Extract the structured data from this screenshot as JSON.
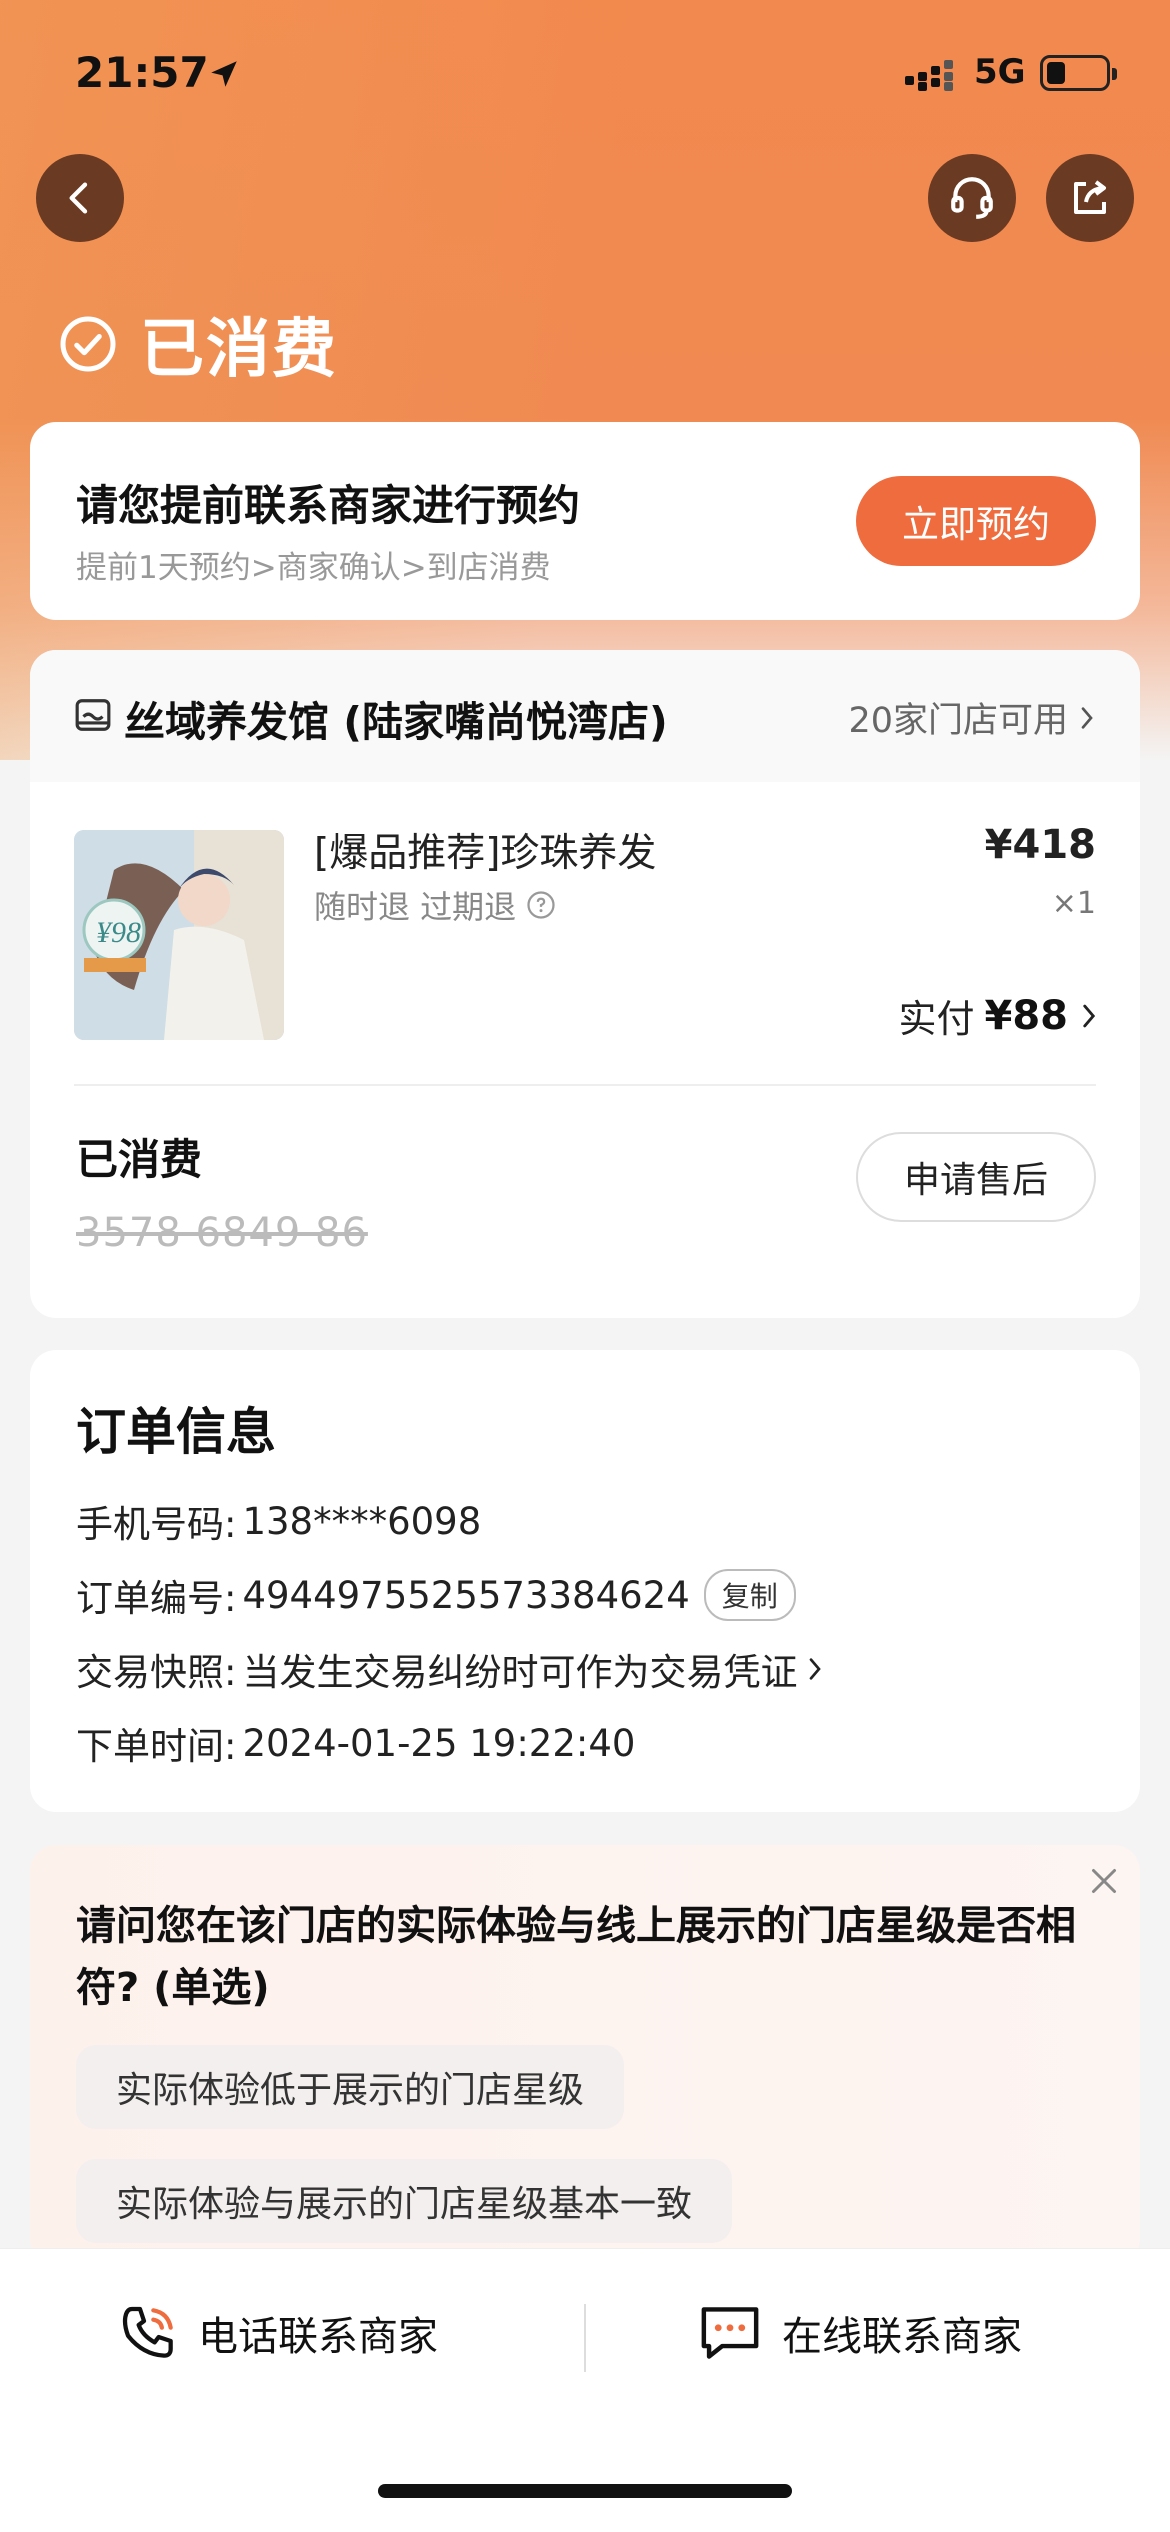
{
  "status_bar": {
    "time": "21:57",
    "network": "5G"
  },
  "header": {
    "status_title": "已消费"
  },
  "booking": {
    "title": "请您提前联系商家进行预约",
    "steps": "提前1天预约>商家确认>到店消费",
    "button": "立即预约"
  },
  "store": {
    "name": "丝域养发馆 (陆家嘴尚悦湾店)",
    "available": "20家门店可用",
    "product": {
      "name": "[爆品推荐]珍珠养发",
      "tags": "随时退 过期退",
      "price": "¥418",
      "qty": "×1",
      "paid_label": "实付",
      "paid_amount": "¥88",
      "image_text": "¥98"
    },
    "consumed_label": "已消费",
    "voucher_code": "3578 6849 86",
    "after_sale_button": "申请售后"
  },
  "order_info": {
    "title": "订单信息",
    "phone_label": "手机号码:",
    "phone_value": "138****6098",
    "order_no_label": "订单编号:",
    "order_no_value": "4944975525573384624",
    "copy_button": "复制",
    "snapshot_label": "交易快照:",
    "snapshot_value": "当发生交易纠纷时可作为交易凭证",
    "time_label": "下单时间:",
    "time_value": "2024-01-25 19:22:40"
  },
  "survey": {
    "question": "请问您在该门店的实际体验与线上展示的门店星级是否相符? (单选)",
    "options": [
      "实际体验低于展示的门店星级",
      "实际体验与展示的门店星级基本一致"
    ]
  },
  "bottom_bar": {
    "phone_contact": "电话联系商家",
    "online_contact": "在线联系商家"
  },
  "colors": {
    "accent": "#ef6c3f",
    "header_bg": "#f2894e"
  }
}
